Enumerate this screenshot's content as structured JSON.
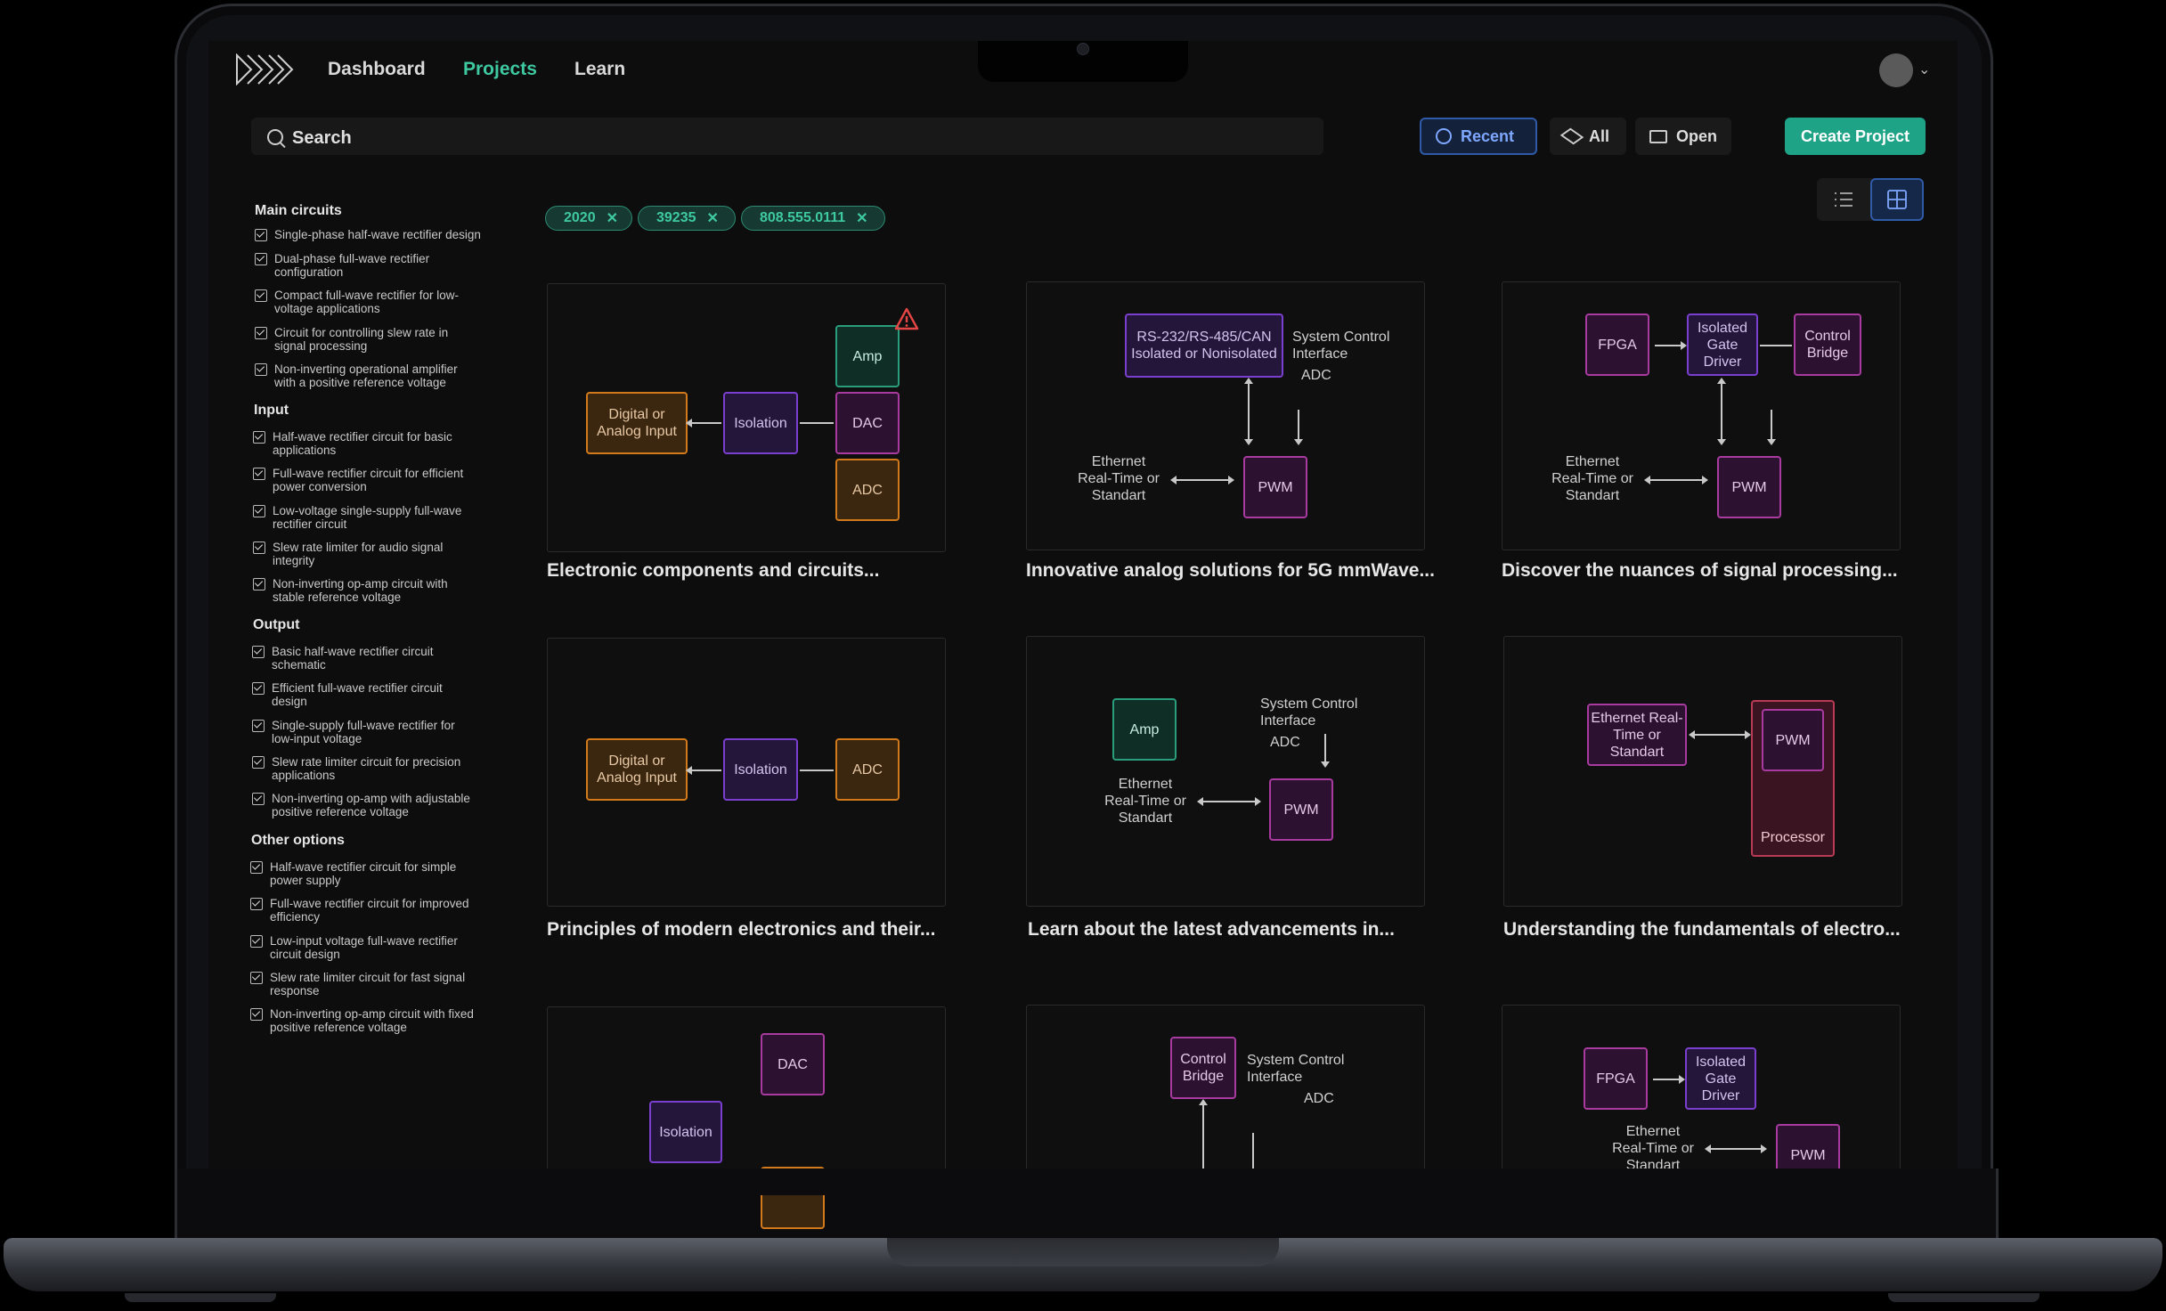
{
  "nav": {
    "dashboard": "Dashboard",
    "projects": "Projects",
    "learn": "Learn"
  },
  "search": {
    "placeholder": "Search"
  },
  "actions": {
    "recent": "Recent",
    "all": "All",
    "open": "Open",
    "create": "Create Project"
  },
  "filters": [
    "2020",
    "39235",
    "808.555.0111"
  ],
  "sidebar": {
    "sections": [
      {
        "title": "Main circuits",
        "items": [
          "Single-phase half-wave rectifier design",
          "Dual-phase full-wave rectifier configuration",
          "Compact full-wave rectifier for low-voltage applications",
          "Circuit for controlling slew rate in signal processing",
          "Non-inverting operational amplifier with a positive reference voltage"
        ]
      },
      {
        "title": "Input",
        "items": [
          "Half-wave rectifier circuit for basic applications",
          "Full-wave rectifier circuit for efficient power conversion",
          "Low-voltage single-supply full-wave rectifier circuit",
          "Slew rate limiter for audio signal integrity",
          "Non-inverting op-amp circuit with stable reference voltage"
        ]
      },
      {
        "title": "Output",
        "items": [
          "Basic half-wave rectifier circuit schematic",
          "Efficient full-wave rectifier circuit design",
          "Single-supply full-wave rectifier for low-input voltage",
          "Slew rate limiter circuit for precision applications",
          "Non-inverting op-amp with adjustable positive reference voltage"
        ]
      },
      {
        "title": "Other options",
        "items": [
          "Half-wave rectifier circuit for simple power supply",
          "Full-wave rectifier circuit for improved efficiency",
          "Low-input voltage full-wave rectifier circuit design",
          "Slew rate limiter circuit for fast signal response",
          "Non-inverting op-amp circuit with fixed positive reference voltage"
        ]
      }
    ]
  },
  "cards": [
    {
      "title": "Electronic components and circuits...",
      "labels": {
        "input": "Digital or Analog Input",
        "isolation": "Isolation",
        "amp": "Amp",
        "dac": "DAC",
        "adc": "ADC"
      }
    },
    {
      "title": "Innovative analog solutions for 5G mmWave...",
      "labels": {
        "rs": "RS-232/RS-485/CAN Isolated or Nonisolated",
        "sci": "System Control Interface",
        "adc": "ADC",
        "eth": "Ethernet Real-Time or Standart",
        "pwm": "PWM"
      }
    },
    {
      "title": "Discover the nuances of signal processing...",
      "labels": {
        "fpga": "FPGA",
        "gate": "Isolated Gate Driver",
        "bridge": "Control Bridge",
        "eth": "Ethernet Real-Time or Standart",
        "pwm": "PWM"
      }
    },
    {
      "title": "Principles of modern electronics and their...",
      "labels": {
        "input": "Digital or Analog Input",
        "isolation": "Isolation",
        "adc": "ADC"
      }
    },
    {
      "title": "Learn about the latest advancements in...",
      "labels": {
        "amp": "Amp",
        "sci": "System Control Interface",
        "adc": "ADC",
        "eth": "Ethernet Real-Time or Standart",
        "pwm": "PWM"
      }
    },
    {
      "title": "Understanding the fundamentals of electro...",
      "labels": {
        "eth": "Ethernet Real-Time or Standart",
        "pwm": "PWM",
        "processor": "Processor"
      }
    },
    {
      "title": "",
      "labels": {
        "dac": "DAC",
        "isolation": "Isolation"
      }
    },
    {
      "title": "",
      "labels": {
        "bridge": "Control Bridge",
        "sci": "System Control Interface",
        "adc": "ADC"
      }
    },
    {
      "title": "",
      "labels": {
        "fpga": "FPGA",
        "gate": "Isolated Gate Driver",
        "eth": "Ethernet Real-Time or Standart",
        "pwm": "PWM"
      }
    }
  ],
  "colors": {
    "accent": "#3ec9a0",
    "primary_button": "#1fa387",
    "selected_blue": "#2f5aa8",
    "background": "#0d0d0e"
  }
}
